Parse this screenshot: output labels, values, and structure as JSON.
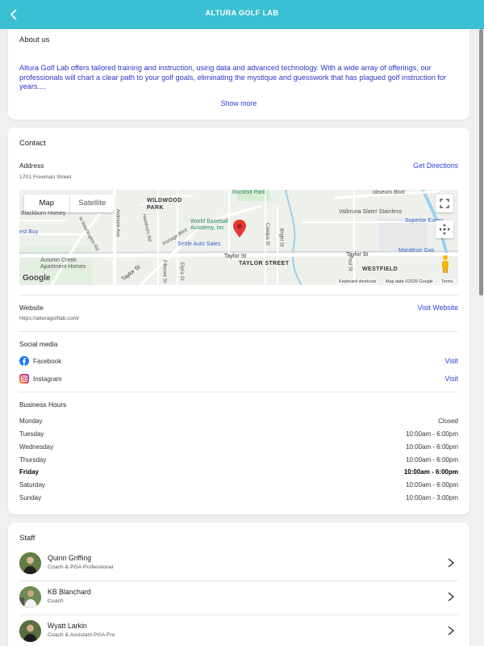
{
  "header": {
    "title": "ALTURA GOLF LAB"
  },
  "about": {
    "title": "About us",
    "text": "Altura Golf Lab offers tailored training and instruction, using data and advanced technology. With a wide array of offerings, our professionals will chart a clear path to your golf goals, eliminating the mystique and guesswork that has plagued golf instruction for years....",
    "show_more": "Show more"
  },
  "contact": {
    "title": "Contact",
    "address_label": "Address",
    "address": "1701 Freeman Street",
    "directions": "Get Directions",
    "map": {
      "tab_map": "Map",
      "tab_satellite": "Satellite",
      "labels": {
        "wildwood_park": "WILDWOOD\nPARK",
        "rockhill_park": "Rockhill Park",
        "world_baseball": "World Baseball\nAcademy, Inc",
        "settle_auto": "Settle Auto Sales",
        "taylor_street": "TAYLOR STREET",
        "taylor_st_center": "Taylor St",
        "taylor_st_right": "Taylor St",
        "taylor_st_left": "Taylor St",
        "westfield": "WESTFIELD",
        "valbruna": "Valbruna Slater Stainless",
        "superior": "Superior Essex",
        "marathon": "Marathon Gas",
        "autumn_creek": "Autumn Creek\nApartment Homes",
        "blackburn": "Blackburn Homey",
        "best_buy": "est Buy",
        "washington": "N Washington Rd",
        "ardmore": "Ardmore Ave",
        "hawthorn": "Hawthorn Rd",
        "portage": "Portage Blvd",
        "fillmore": "Fillmore St",
        "elyria": "Elyria St",
        "catalpa": "Catalpa St",
        "bright": "Bright St",
        "paul": "Paul St",
        "coliseum": "oliseum Blvd",
        "google": "Google",
        "shortcuts": "Keyboard shortcuts",
        "map_data": "Map data ©2025 Google",
        "terms": "Terms"
      }
    },
    "website_label": "Website",
    "website_url": "https://alturagolflab.com/",
    "visit_website": "Visit Website",
    "social_label": "Social media",
    "social": [
      {
        "name": "Facebook",
        "action": "Visit"
      },
      {
        "name": "Instagram",
        "action": "Visit"
      }
    ],
    "hours_label": "Business Hours",
    "hours": [
      {
        "day": "Monday",
        "time": "Closed"
      },
      {
        "day": "Tuesday",
        "time": "10:00am - 6:00pm"
      },
      {
        "day": "Wednesday",
        "time": "10:00am - 6:00pm"
      },
      {
        "day": "Thursday",
        "time": "10:00am - 6:00pm"
      },
      {
        "day": "Friday",
        "time": "10:00am - 6:00pm"
      },
      {
        "day": "Saturday",
        "time": "10:00am - 6:00pm"
      },
      {
        "day": "Sunday",
        "time": "10:00am - 3:00pm"
      }
    ]
  },
  "staff": {
    "title": "Staff",
    "members": [
      {
        "name": "Quinn Griffing",
        "role": "Coach & PGA Professional"
      },
      {
        "name": "KB Blanchard",
        "role": "Coach"
      },
      {
        "name": "Wyatt Larkin",
        "role": "Coach & Assistant PGA Pro"
      }
    ]
  },
  "colors": {
    "header": "#3bc0d3",
    "link": "#2a42d8",
    "facebook": "#1877f2",
    "map_pin": "#e53935"
  }
}
